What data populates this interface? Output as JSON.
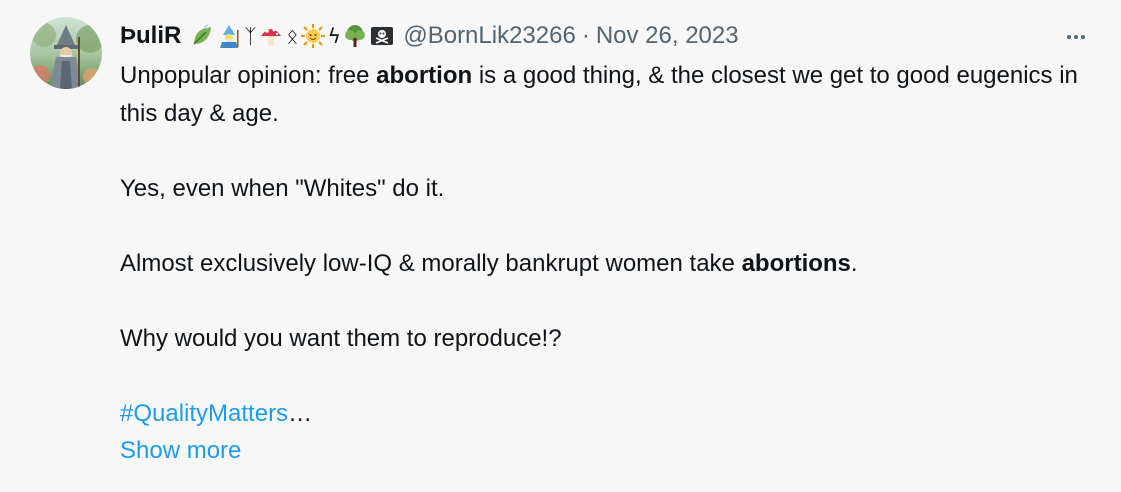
{
  "tweet": {
    "author": {
      "display_name": "ÞuliR",
      "handle": "@BornLik23266",
      "avatar": "wizard-avatar"
    },
    "separator": "·",
    "date": "Nov 26, 2023",
    "name_emojis": [
      "leaf-icon",
      "mage-icon",
      "rune-algiz",
      "mushroom-icon",
      "rune-othala",
      "sun-face-icon",
      "rune-sowilo",
      "tree-icon",
      "pirate-flag-icon"
    ],
    "runes": {
      "algiz": "ᛉ",
      "othala": "ᛟ",
      "sowilo": "ϟ"
    },
    "more_icon": "more-dots-icon",
    "text": {
      "line1_pre": "Unpopular opinion: free ",
      "line1_bold": "abortion",
      "line1_post": " is a good thing, & the closest we get to good eugenics in this day & age.",
      "para2": "Yes, even when \"Whites\" do it.",
      "para3_pre": "Almost exclusively low-IQ & morally bankrupt women take ",
      "para3_bold": "abortions",
      "para3_post": ".",
      "para4": "Why would you want them to reproduce!?",
      "hashtag": "#QualityMatters",
      "ellipsis": "…",
      "show_more": "Show more"
    }
  },
  "colors": {
    "background": "#f7f7f7",
    "text": "#0f1419",
    "muted": "#536471",
    "link": "#1d9bf0"
  }
}
